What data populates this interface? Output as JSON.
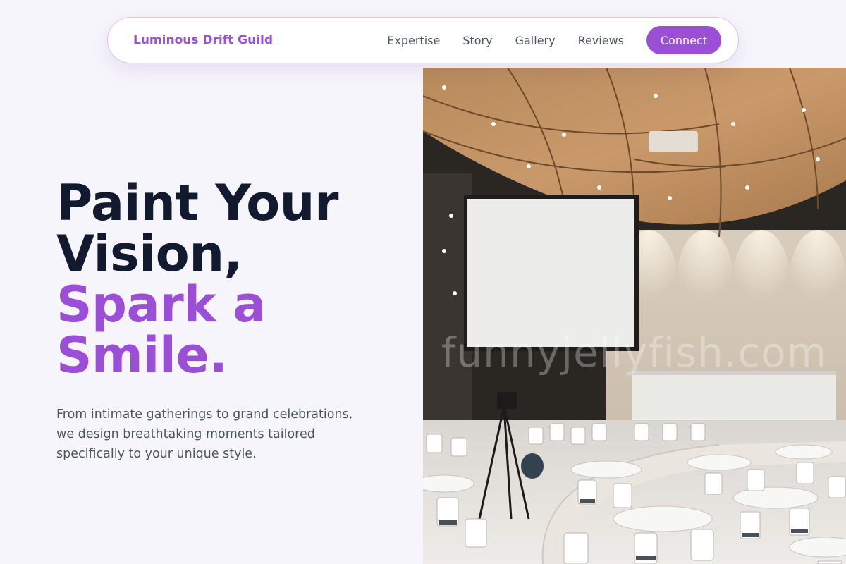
{
  "nav": {
    "brand": "Luminous Drift Guild",
    "links": [
      "Expertise",
      "Story",
      "Gallery",
      "Reviews"
    ],
    "cta_label": "Connect"
  },
  "hero": {
    "headline_line1": "Paint Your",
    "headline_line2": "Vision,",
    "headline_accent_line1": "Spark a",
    "headline_accent_line2": "Smile.",
    "description": "From intimate gatherings to grand celebrations, we design breathtaking moments tailored specifically to your unique style.",
    "image_watermark": "funnyjellyfish.com"
  },
  "colors": {
    "accent": "#9b4ed6",
    "heading": "#111a2e",
    "body_text": "#4b5566",
    "background": "#f7f5fc"
  }
}
